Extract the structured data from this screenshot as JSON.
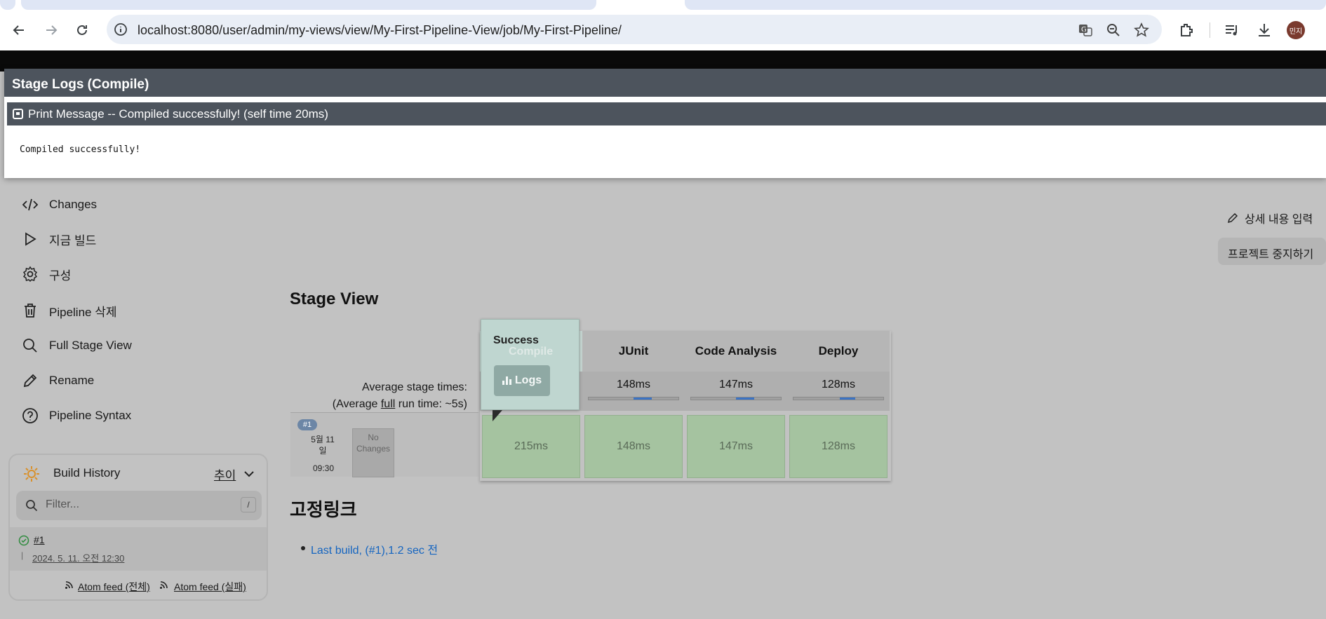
{
  "browser": {
    "url": "localhost:8080/user/admin/my-views/view/My-First-Pipeline-View/job/My-First-Pipeline/",
    "avatar_text": "민지"
  },
  "modal": {
    "title": "Stage Logs (Compile)",
    "log_header": "Print Message -- Compiled successfully! (self time 20ms)",
    "log_output": "Compiled successfully!"
  },
  "sidebar": {
    "items": [
      {
        "label": "Changes",
        "icon": "code-icon"
      },
      {
        "label": "지금 빌드",
        "icon": "play-icon"
      },
      {
        "label": "구성",
        "icon": "gear-icon"
      },
      {
        "label": "Pipeline 삭제",
        "icon": "trash-icon"
      },
      {
        "label": "Full Stage View",
        "icon": "search-icon"
      },
      {
        "label": "Rename",
        "icon": "pencil-icon"
      },
      {
        "label": "Pipeline Syntax",
        "icon": "help-icon"
      }
    ]
  },
  "build_history": {
    "title": "Build History",
    "trend_label": "추이",
    "filter_placeholder": "Filter...",
    "filter_shortcut": "/",
    "builds": [
      {
        "number": "#1",
        "date": "2024. 5. 11. 오전 12:30",
        "status": "success"
      }
    ],
    "feed_all": "Atom feed (전체)",
    "feed_failed": "Atom feed (실패)"
  },
  "actions": {
    "edit_description": "상세 내용 입력",
    "disable_project": "프로젝트 중지하기"
  },
  "stage_view": {
    "heading": "Stage View",
    "avg_line1": "Average stage times:",
    "avg_line2_pre": "(Average ",
    "avg_line2_link": "full",
    "avg_line2_post": " run time: ~5s)",
    "stages": [
      {
        "name": "Compile",
        "avg": "215ms",
        "cell": "215ms",
        "bar_fraction": 0.28
      },
      {
        "name": "JUnit",
        "avg": "148ms",
        "cell": "148ms",
        "bar_fraction": 0.2
      },
      {
        "name": "Code Analysis",
        "avg": "147ms",
        "cell": "147ms",
        "bar_fraction": 0.2
      },
      {
        "name": "Deploy",
        "avg": "128ms",
        "cell": "128ms",
        "bar_fraction": 0.17
      }
    ],
    "build": {
      "badge": "#1",
      "date": "5월 11 일",
      "time": "09:30",
      "changes": "No Changes"
    },
    "popover": {
      "status": "Success",
      "stage": "Compile",
      "logs_label": "Logs"
    }
  },
  "permalinks": {
    "heading": "고정링크",
    "items": [
      "Last build, (#1),1.2 sec 전"
    ]
  },
  "colors": {
    "modal_header": "#4d545d",
    "success_cell": "#a5c3a0",
    "bar_fill": "#3b73c4",
    "link": "#1565c0"
  }
}
